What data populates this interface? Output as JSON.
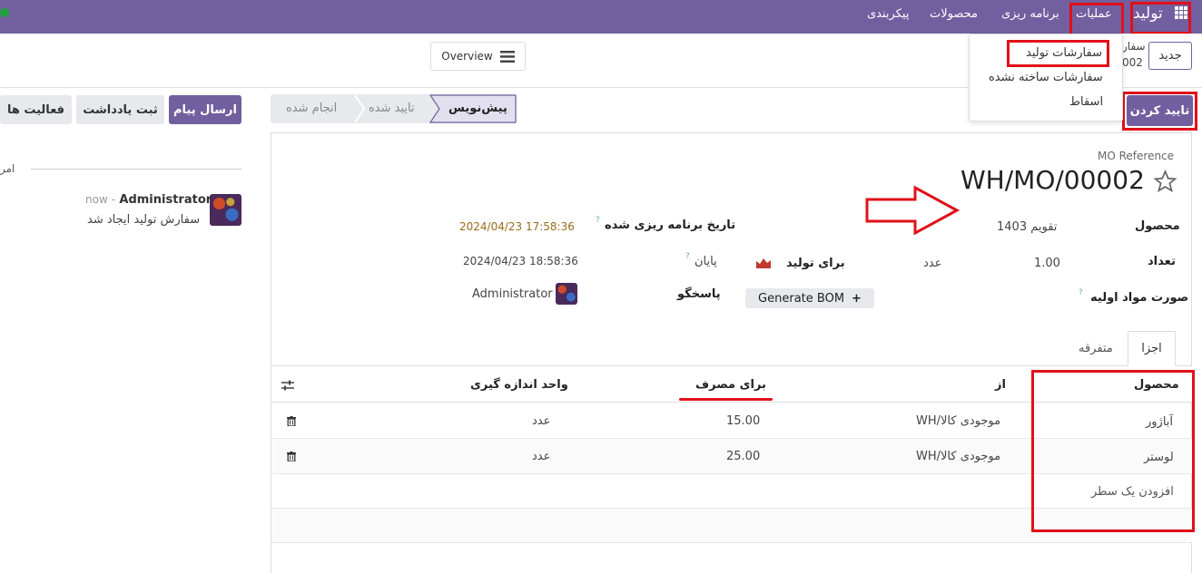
{
  "navbar": {
    "app_title": "تولید",
    "menus": [
      "عملیات",
      "برنامه ریزی",
      "محصولات",
      "پیکربندی"
    ]
  },
  "dropdown": {
    "items": [
      "سفارشات تولید",
      "سفارشات ساخته نشده",
      "اسقاط"
    ]
  },
  "control": {
    "new_button": "جدید",
    "breadcrumb_line1": "سفار",
    "breadcrumb_line2": "002",
    "overview_label": "Overview"
  },
  "actions": {
    "confirm_button": "تایید کردن",
    "statusbar": [
      "پیش‌نویس",
      "تایید شده",
      "انجام شده"
    ],
    "active_status": "پیش‌نویس"
  },
  "chatter": {
    "send_message": "ارسال پیام",
    "log_note": "ثبت یادداشت",
    "activities": "فعالیت ها",
    "today": "امر",
    "author": "Administrator",
    "time": "now",
    "message": "سفارش تولید ایجاد شد"
  },
  "form": {
    "ref_label": "MO Reference",
    "ref_value": "WH/MO/00002",
    "product_label": "محصول",
    "product_value": "تقویم 1403",
    "qty_label": "تعداد",
    "qty_value": "1.00",
    "uom_value": "عدد",
    "to_produce": "برای تولید",
    "bom_label": "صورت مواد اولیه",
    "generate_bom": "Generate BOM",
    "scheduled_label": "تاریخ برنامه ریزی شده",
    "scheduled_value": "2024/04/23 17:58:36",
    "end_label": "پایان",
    "end_value": "2024/04/23 18:58:36",
    "responsible_label": "پاسخگو",
    "responsible_value": "Administrator"
  },
  "tabs": [
    "اجزا",
    "متفرقه"
  ],
  "table": {
    "headers": {
      "product": "محصول",
      "from": "از",
      "to_consume": "برای مصرف",
      "uom": "واحد اندازه گیری"
    },
    "rows": [
      {
        "product": "آباژور",
        "from": "WH/موجودی کالا",
        "qty": "15.00",
        "uom": "عدد"
      },
      {
        "product": "لوستر",
        "from": "WH/موجودی کالا",
        "qty": "25.00",
        "uom": "عدد"
      }
    ],
    "add_line": "افزودن یک سطر"
  },
  "colors": {
    "brand": "#715f9f",
    "annotation": "#e0101a",
    "scheduled_date": "#9a6b1a"
  }
}
